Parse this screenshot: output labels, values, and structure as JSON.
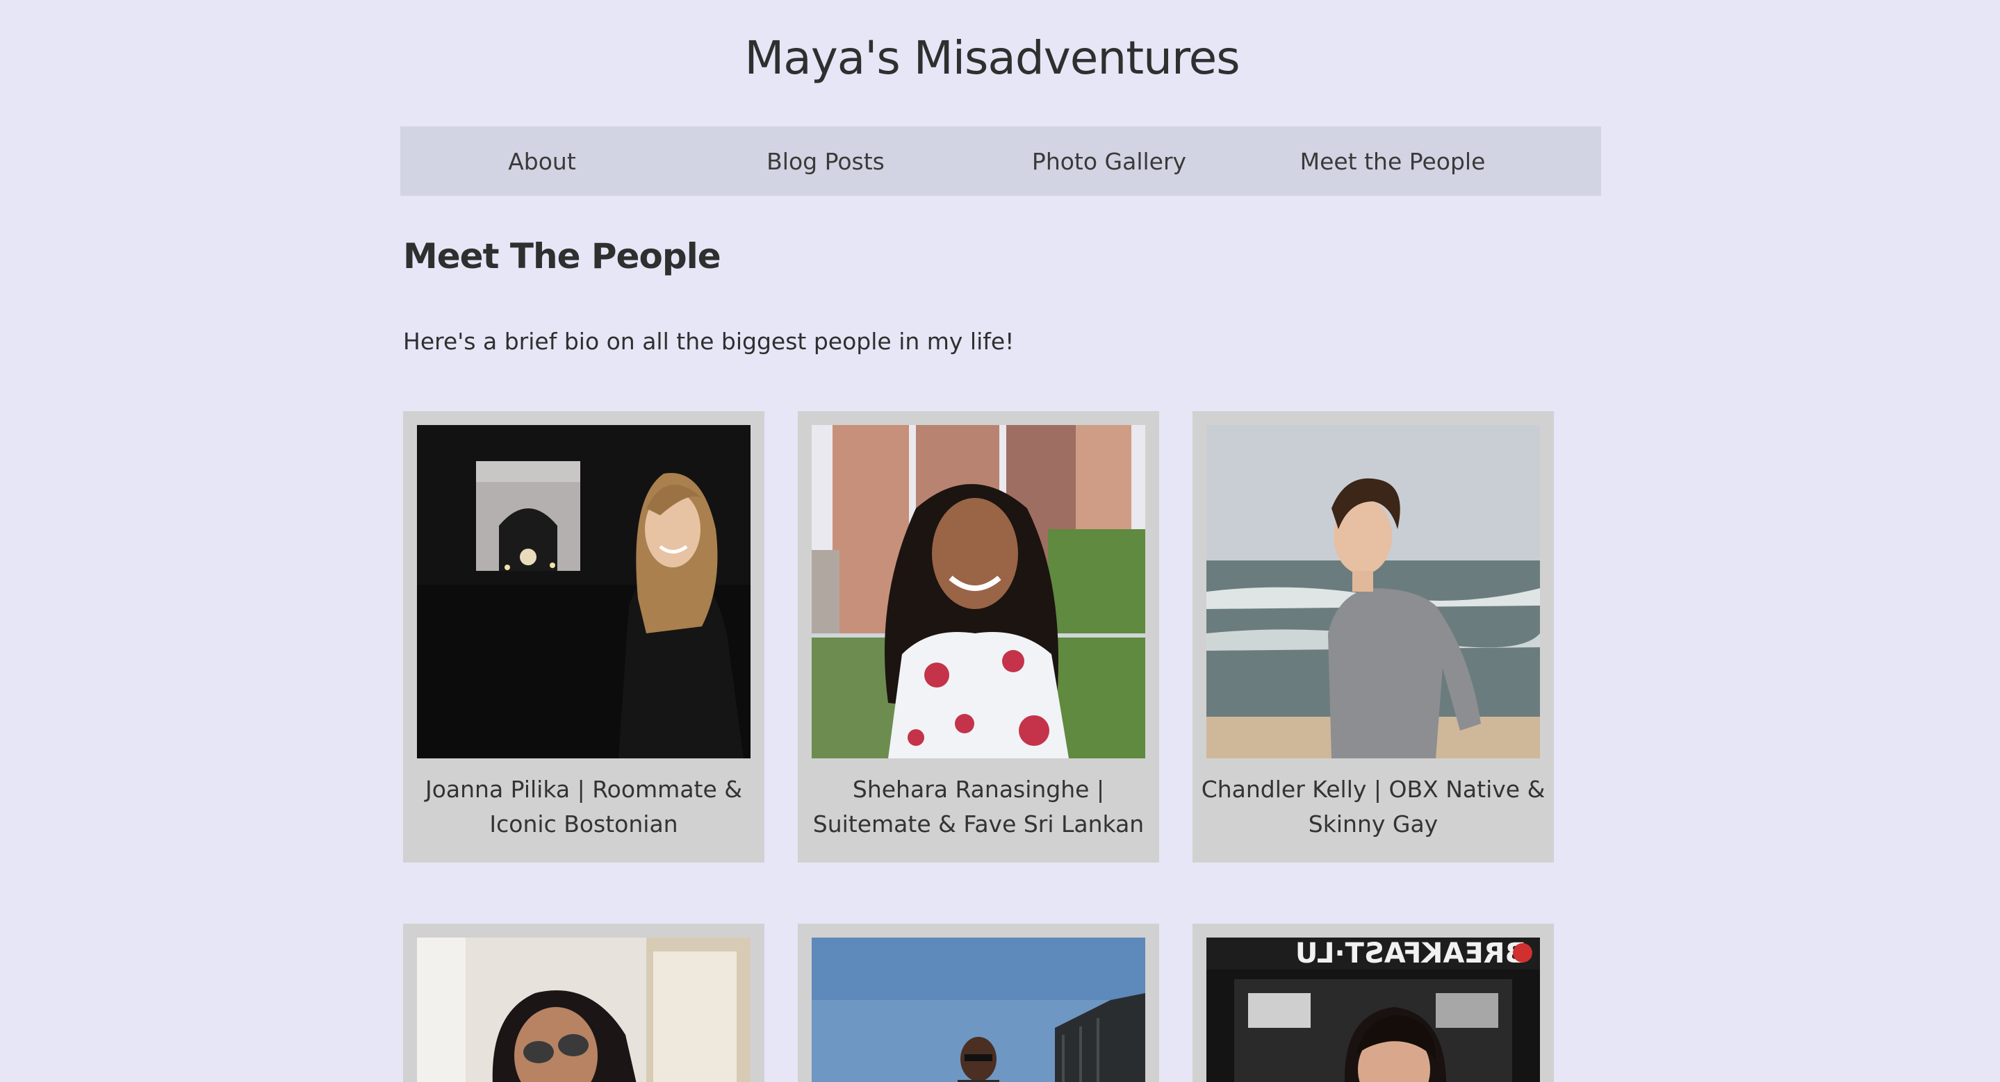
{
  "site": {
    "title": "Maya's Misadventures"
  },
  "nav": {
    "items": [
      {
        "label": "About"
      },
      {
        "label": "Blog Posts"
      },
      {
        "label": "Photo Gallery"
      },
      {
        "label": "Meet the People"
      }
    ]
  },
  "main": {
    "heading": "Meet The People",
    "intro": "Here's a brief bio on all the biggest people in my life!",
    "people": [
      {
        "caption": "Joanna Pilika | Roommate & Iconic Bostonian"
      },
      {
        "caption": "Shehara Ranasinghe | Suitemate & Fave Sri Lankan"
      },
      {
        "caption": "Chandler Kelly | OBX Native & Skinny Gay"
      },
      {
        "caption": ""
      },
      {
        "caption": ""
      },
      {
        "caption": ""
      }
    ],
    "sign_text": "BREAKFAST·LU"
  },
  "colors": {
    "background": "#e6e6f7",
    "nav_background": "#d2d4e3",
    "card_background": "#d1d1d1",
    "text": "#2f2f2f"
  }
}
